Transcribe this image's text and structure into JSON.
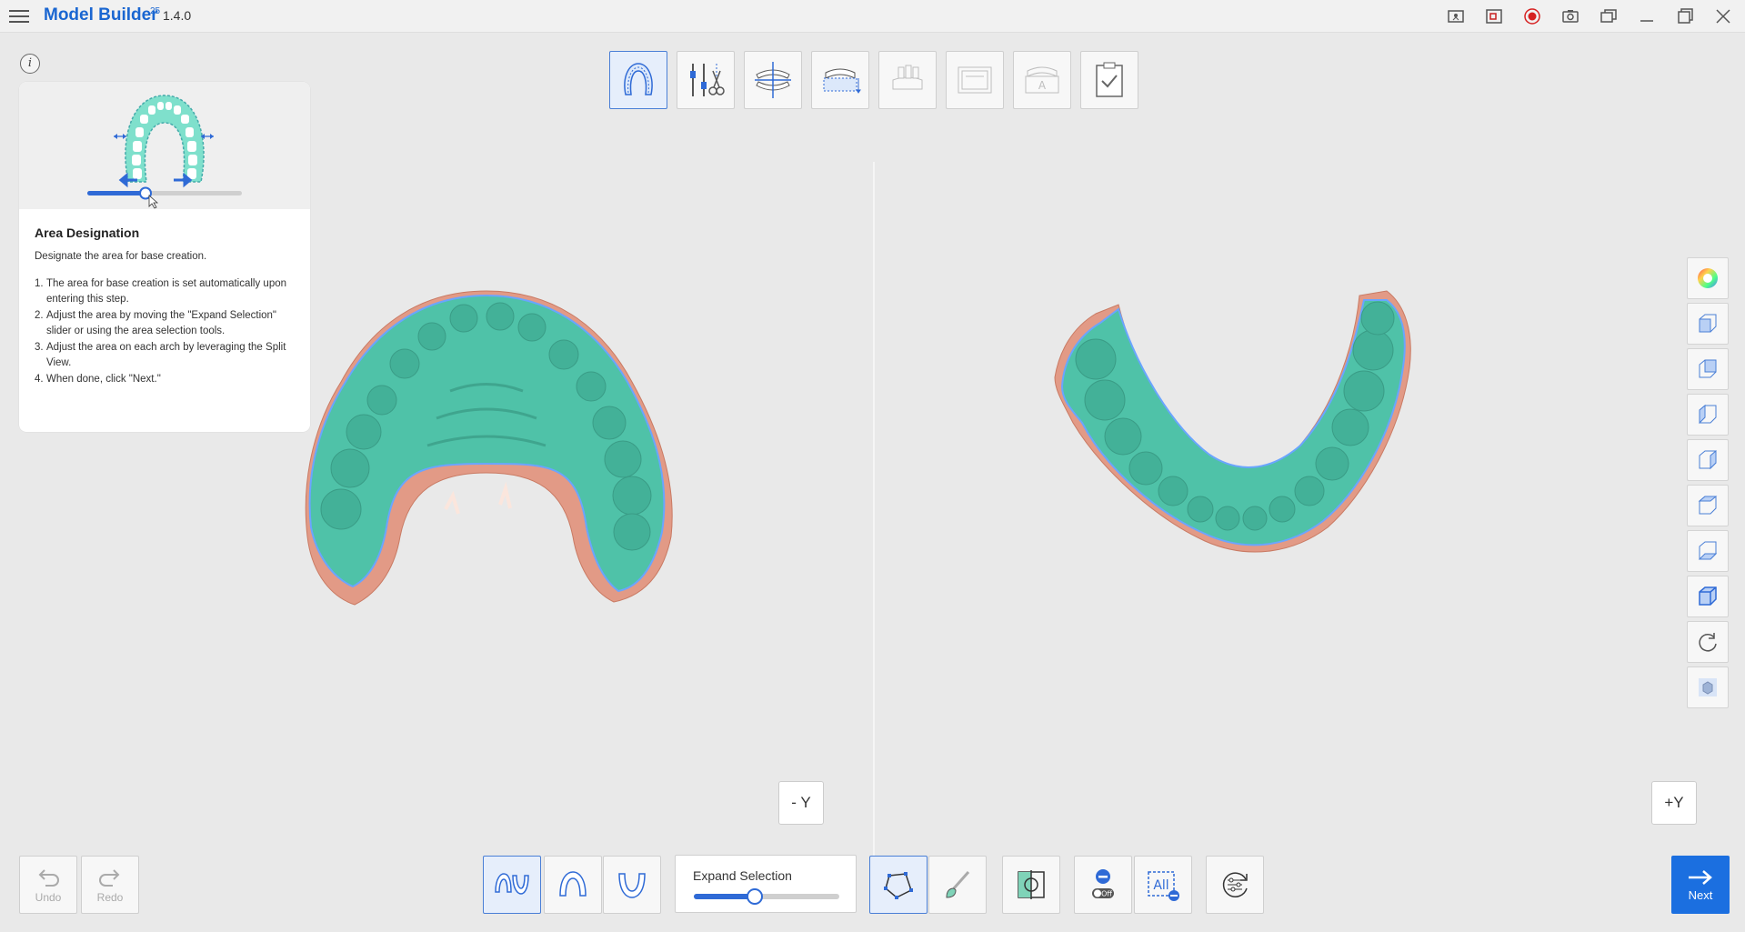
{
  "app": {
    "title": "Model Builder",
    "badge": "25",
    "version": "1.4.0"
  },
  "window_icons": [
    "screen-capture-icon",
    "region-capture-icon",
    "record-icon",
    "camera-icon",
    "windows-icon",
    "minimize-icon",
    "maximize-icon",
    "close-icon"
  ],
  "info_button": "i",
  "guide": {
    "title": "Area Designation",
    "description": "Designate the area for base creation.",
    "steps": [
      {
        "num": "1.",
        "text": "The area for base creation is set automatically upon entering this step."
      },
      {
        "num": "2.",
        "text": "Adjust the area by moving the \"Expand Selection\" slider or using the area selection tools."
      },
      {
        "num": "3.",
        "text": "Adjust the area on each arch by leveraging the Split View."
      },
      {
        "num": "4.",
        "text": "When done, click \"Next.\""
      }
    ]
  },
  "step_toolbar": [
    {
      "name": "area-designation",
      "active": true
    },
    {
      "name": "trim-tools",
      "active": false
    },
    {
      "name": "occlusion-align",
      "active": false
    },
    {
      "name": "base-creation",
      "active": false
    },
    {
      "name": "die-setup",
      "active": false,
      "disabled": true
    },
    {
      "name": "base-label",
      "active": false,
      "disabled": true
    },
    {
      "name": "text-label",
      "active": false,
      "disabled": true
    },
    {
      "name": "finish-check",
      "active": false
    }
  ],
  "views": {
    "left_axis": "- Y",
    "right_axis": "+Y"
  },
  "view_tools": [
    "color-wheel-icon",
    "cube-front-icon",
    "cube-back-icon",
    "cube-left-icon",
    "cube-right-icon",
    "cube-top-icon",
    "cube-bottom-icon",
    "cube-iso-icon",
    "rotate-icon",
    "model-icon"
  ],
  "bottom": {
    "undo_label": "Undo",
    "redo_label": "Redo",
    "expand_label": "Expand Selection",
    "expand_value": 0.42,
    "next_label": "Next",
    "arch_modes": [
      "both-arches",
      "upper-arch",
      "lower-arch"
    ],
    "tools": [
      "polygon-select",
      "brush-select",
      "split-view",
      "deselect-toggle",
      "select-all-minus",
      "reset-selection"
    ],
    "toggle_label": "Off",
    "all_label": "All"
  },
  "colors": {
    "accent": "#1a66d1",
    "model_selected": "#4fc2a8",
    "model_unselected": "#e29a86",
    "selection_edge": "#6aa5ff"
  }
}
